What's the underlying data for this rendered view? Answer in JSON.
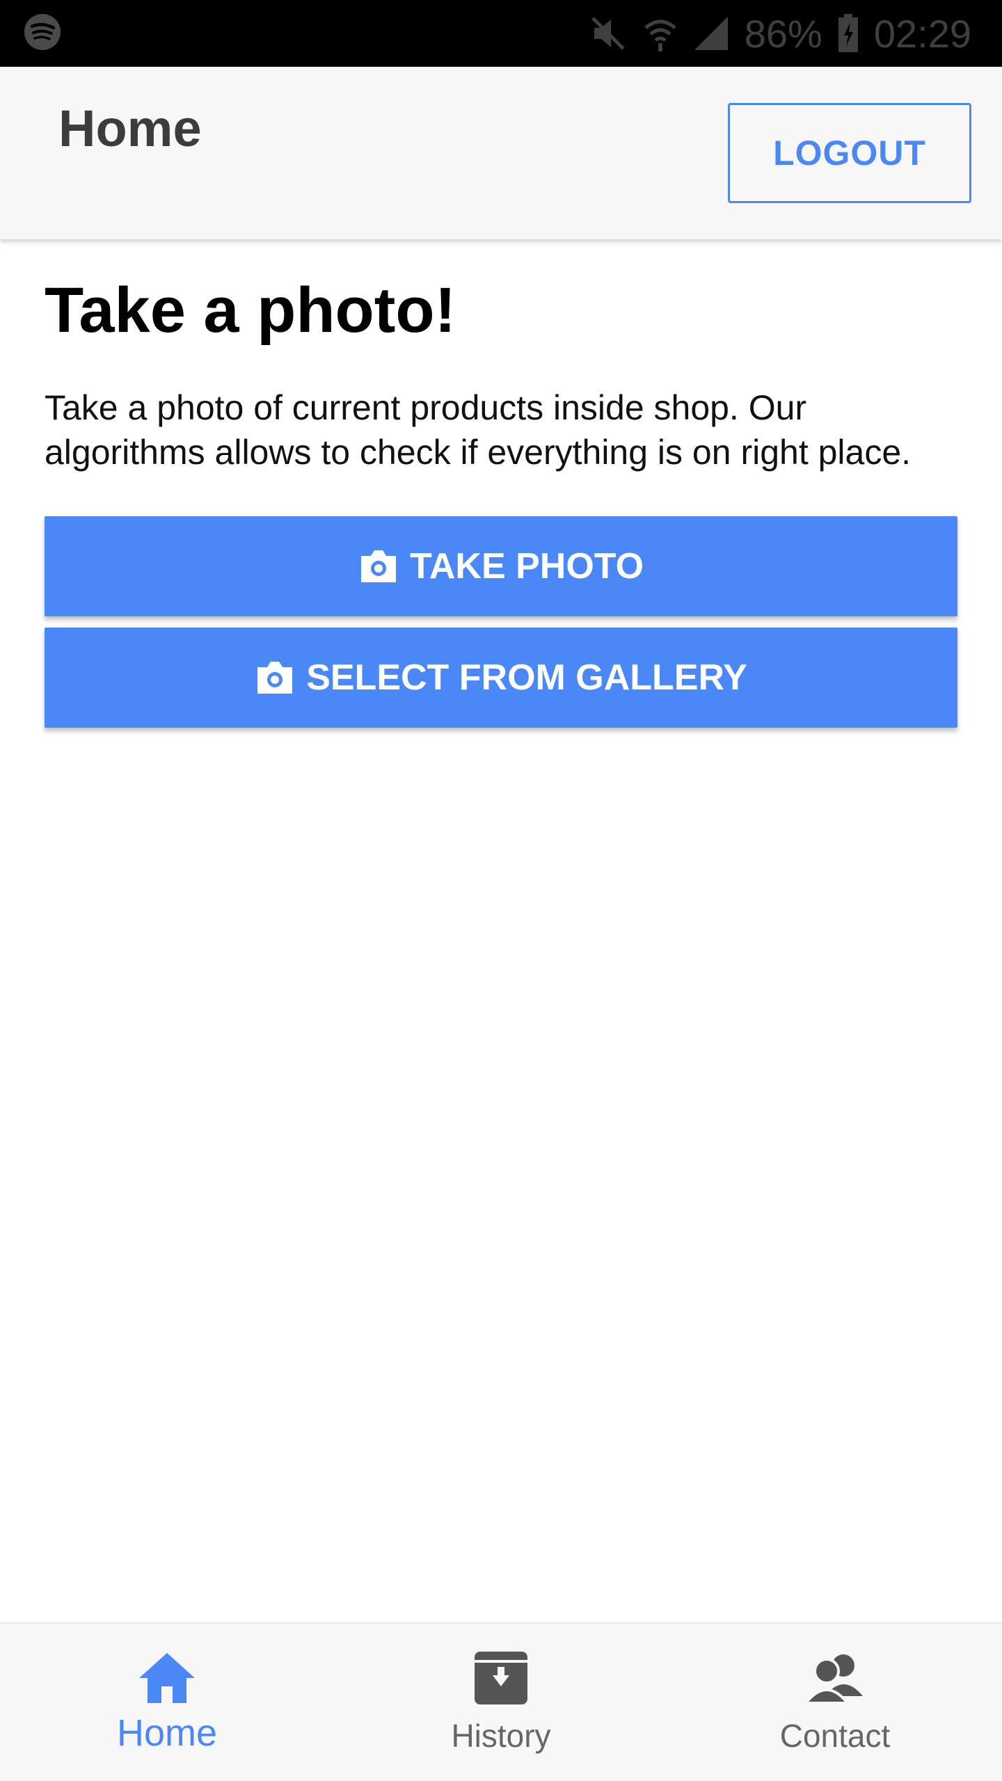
{
  "status_bar": {
    "battery": "86%",
    "time": "02:29",
    "icons": [
      "spotify-icon",
      "mute-icon",
      "wifi-icon",
      "signal-icon",
      "battery-charging-icon"
    ]
  },
  "header": {
    "title": "Home",
    "logout_label": "LOGOUT"
  },
  "main": {
    "title": "Take a photo!",
    "description": "Take a photo of current products inside shop. Our algorithms allows to check if everything is on right place.",
    "take_photo_label": "TAKE PHOTO",
    "gallery_label": "SELECT FROM GALLERY"
  },
  "bottom_nav": {
    "items": [
      {
        "label": "Home",
        "icon": "home-icon",
        "active": true
      },
      {
        "label": "History",
        "icon": "archive-icon",
        "active": false
      },
      {
        "label": "Contact",
        "icon": "contacts-icon",
        "active": false
      }
    ]
  },
  "colors": {
    "accent": "#4a88f5",
    "button_bg": "#4a88f8",
    "header_bg": "#f7f7f7",
    "status_bar_bg": "#000000"
  }
}
